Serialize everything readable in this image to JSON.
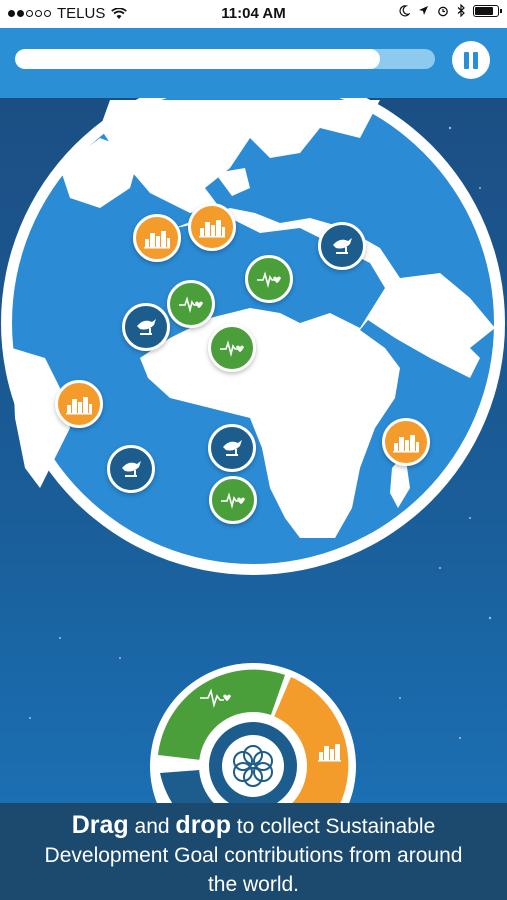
{
  "status_bar": {
    "carrier": "TELUS",
    "time": "11:04 AM",
    "battery_level": 0.9
  },
  "game": {
    "timer_progress": 0.87,
    "pause_label": "pause-icon"
  },
  "tokens": [
    {
      "goal": "sustainable-cities",
      "color": "#f49c2b"
    },
    {
      "goal": "sustainable-cities",
      "color": "#f49c2b"
    },
    {
      "goal": "good-health",
      "color": "#4b9f3b"
    },
    {
      "goal": "good-health",
      "color": "#4b9f3b"
    },
    {
      "goal": "good-health",
      "color": "#4b9f3b"
    },
    {
      "goal": "peace-justice",
      "color": "#1c5d8d"
    },
    {
      "goal": "peace-justice",
      "color": "#1c5d8d"
    },
    {
      "goal": "sustainable-cities",
      "color": "#f49c2b"
    },
    {
      "goal": "peace-justice",
      "color": "#1c5d8d"
    },
    {
      "goal": "peace-justice",
      "color": "#1c5d8d"
    },
    {
      "goal": "good-health",
      "color": "#4b9f3b"
    },
    {
      "goal": "sustainable-cities",
      "color": "#f49c2b"
    }
  ],
  "collector": {
    "segments": [
      {
        "goal": "good-health",
        "color": "#4b9f3b"
      },
      {
        "goal": "sustainable-cities",
        "color": "#f49c2b"
      },
      {
        "goal": "peace-justice",
        "color": "#1c5d8d"
      }
    ],
    "center_icon": "sdg-flower-icon"
  },
  "instructions": {
    "drag": "Drag",
    "and": " and ",
    "drop": "drop",
    "rest_line1": " to collect Sustainable",
    "line2": "Development Goal contributions from around",
    "line3": "the world."
  },
  "colors": {
    "orange": "#f49c2b",
    "green": "#4b9f3b",
    "navy": "#1c5d8d",
    "bar_blue": "#2b8fd6"
  }
}
